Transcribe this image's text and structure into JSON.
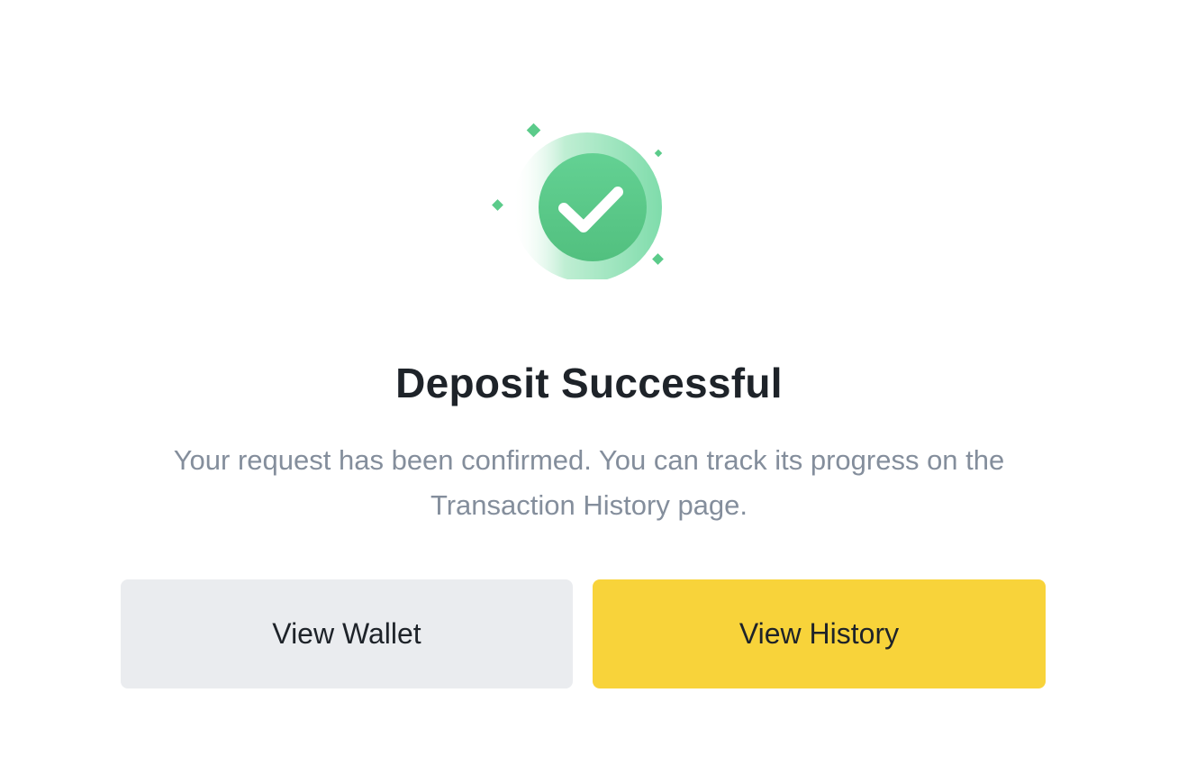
{
  "dialog": {
    "icon": "success-check-icon",
    "title": "Deposit Successful",
    "message": "Your request has been confirmed. You can track its progress on the Transaction History page."
  },
  "actions": {
    "view_wallet_label": "View Wallet",
    "view_history_label": "View History"
  },
  "colors": {
    "success_green": "#5bcb8a",
    "primary_yellow": "#f8d33a",
    "secondary_gray": "#eaecef",
    "title_text": "#1e2329",
    "muted_text": "#848e9c"
  }
}
